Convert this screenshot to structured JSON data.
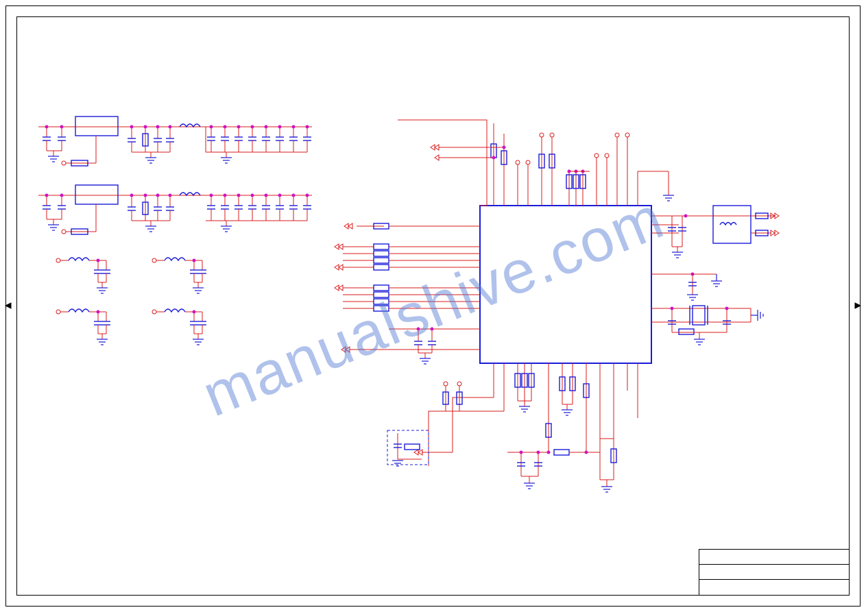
{
  "watermark_text": "manualshive.com",
  "colors": {
    "wire": "#d81b1b",
    "component": "#1b1bd8",
    "junction": "#d013c0",
    "background": "#ffffff"
  },
  "schematic": {
    "main_ic": {
      "type": "IC",
      "shape": "rectangle",
      "pins_estimated": 64
    },
    "power_blocks": [
      {
        "name": "regulator-1",
        "children": [
          "decoupling-cap-bank-1",
          "inductor-filter-1"
        ]
      },
      {
        "name": "regulator-2",
        "children": [
          "decoupling-cap-bank-2",
          "inductor-filter-2"
        ]
      },
      {
        "name": "lc-filter-1"
      },
      {
        "name": "lc-filter-2"
      },
      {
        "name": "lc-filter-3"
      },
      {
        "name": "lc-filter-4"
      }
    ],
    "io_groups": [
      {
        "side": "left",
        "count": 12
      },
      {
        "side": "top",
        "count": 16
      },
      {
        "side": "right",
        "count": 14
      },
      {
        "side": "bottom",
        "count": 14
      }
    ],
    "grounds_estimated": 28,
    "capacitors_estimated": 48,
    "resistors_estimated": 40,
    "inductors_estimated": 8,
    "dashed_option_block": true
  },
  "title_block": {
    "rows": [
      "",
      "",
      ""
    ]
  }
}
